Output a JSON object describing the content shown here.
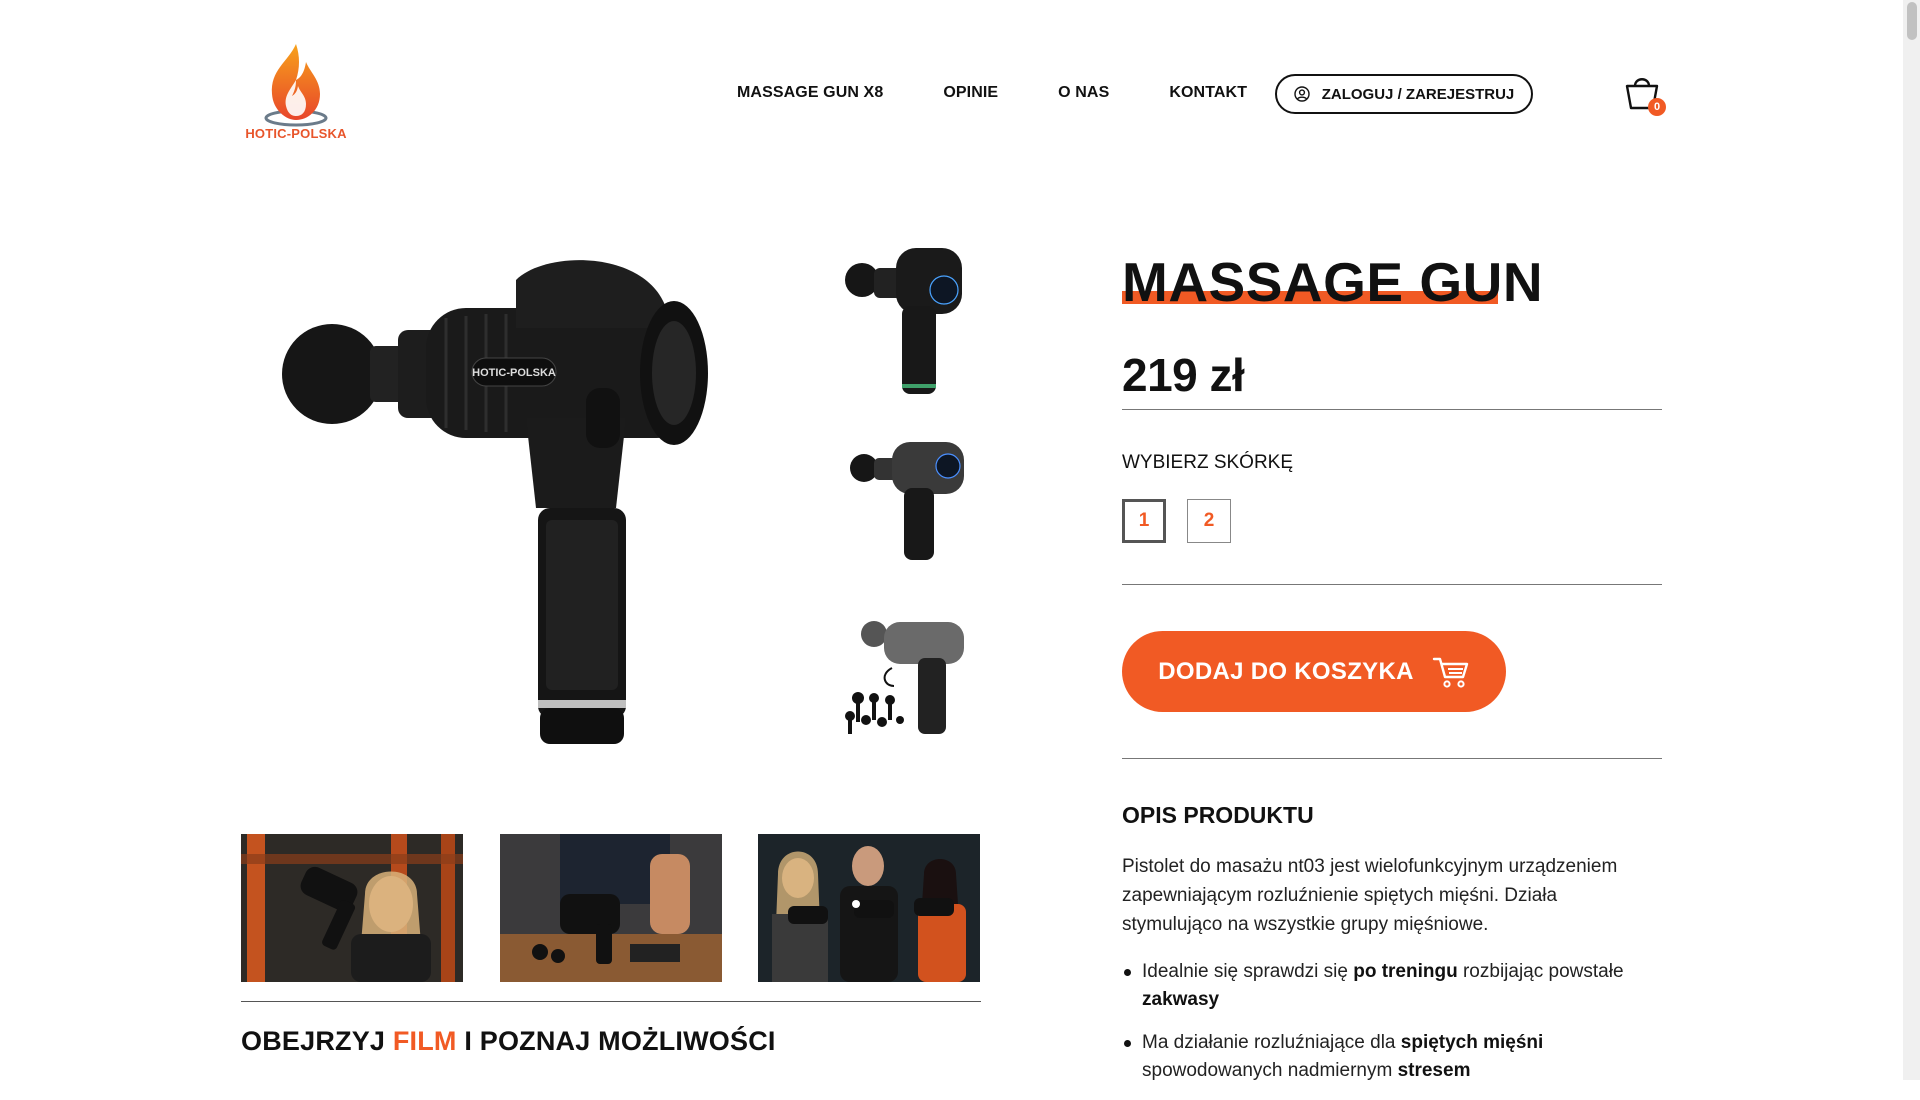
{
  "brand": {
    "logo_text": "HOTIC-POLSKA",
    "accent": "#f15a24"
  },
  "nav": {
    "items": [
      "MASSAGE GUN X8",
      "OPINIE",
      "O NAS",
      "KONTAKT"
    ],
    "login_label": "ZALOGUJ / ZAREJESTRUJ",
    "cart_count": "0"
  },
  "product": {
    "title": "MASSAGE GUN",
    "price": "219 zł",
    "device_logo": "HOTIC-POLSKA",
    "skin_label": "WYBIERZ SKÓRKĘ",
    "skin_options": [
      "1",
      "2"
    ],
    "selected_skin": "1",
    "add_to_cart": "DODAJ DO KOSZYKA"
  },
  "description": {
    "heading": "OPIS PRODUKTU",
    "text": "Pistolet do masażu nt03 jest wielofunkcyjnym urządzeniem zapewniającym rozluźnienie spiętych mięśni. Działa stymulująco na wszystkie grupy mięśniowe.",
    "bullets": [
      {
        "pre": "Idealnie się sprawdzi się ",
        "bold": "po treningu",
        "post": " rozbijając powstałe ",
        "bold2": "zakwasy"
      },
      {
        "pre": "Ma działanie rozluźniające dla ",
        "bold": "spiętych mięśni",
        "post": " spowodowanych nadmiernym ",
        "bold2": "stresem"
      }
    ]
  },
  "video": {
    "part1": "OBEJRZYJ ",
    "part2": "FILM",
    "part3": " I POZNAJ MOŻLIWOŚCI"
  }
}
